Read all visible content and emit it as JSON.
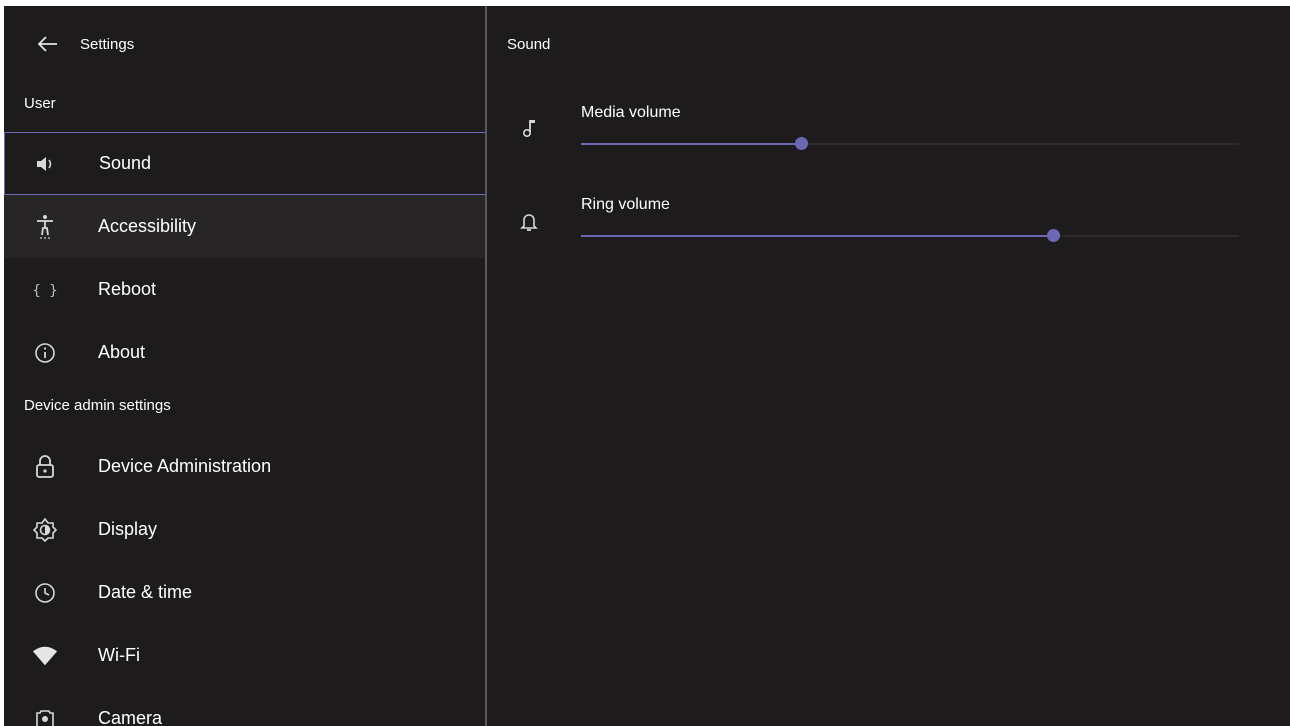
{
  "header": {
    "title": "Settings",
    "back_icon": "arrow-left-icon"
  },
  "sections": {
    "user": "User",
    "device_admin": "Device admin settings"
  },
  "nav": {
    "sound": {
      "label": "Sound",
      "icon": "speaker-icon"
    },
    "accessibility": {
      "label": "Accessibility",
      "icon": "accessibility-icon"
    },
    "reboot": {
      "label": "Reboot",
      "icon": "braces-icon"
    },
    "about": {
      "label": "About",
      "icon": "info-icon"
    },
    "device_admin": {
      "label": "Device Administration",
      "icon": "lock-icon"
    },
    "display": {
      "label": "Display",
      "icon": "brightness-icon"
    },
    "date_time": {
      "label": "Date & time",
      "icon": "clock-icon"
    },
    "wifi": {
      "label": "Wi-Fi",
      "icon": "wifi-icon"
    },
    "camera": {
      "label": "Camera",
      "icon": "camera-icon"
    }
  },
  "selected_item": "Sound",
  "sound_pane": {
    "title": "Sound",
    "media_volume": {
      "label": "Media volume",
      "icon": "music-note-icon",
      "value": 0.335
    },
    "ring_volume": {
      "label": "Ring volume",
      "icon": "bell-icon",
      "value": 0.718
    }
  },
  "colors": {
    "background": "#1d1b1b",
    "accent": "#6c69b4",
    "divider": "#5a5858"
  }
}
